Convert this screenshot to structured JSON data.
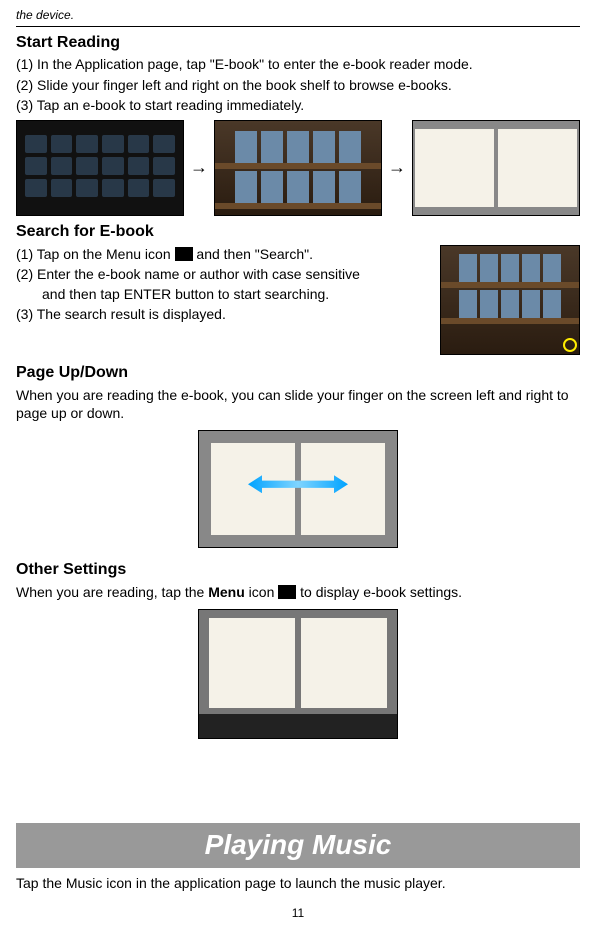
{
  "header_note": "the device.",
  "sections": {
    "start": {
      "title": "Start Reading",
      "line1": "(1) In the Application page, tap \"E-book\" to enter the e-book reader mode.",
      "line2": "(2) Slide your finger left and right on the book shelf to browse e-books.",
      "line3": "(3) Tap an e-book to start reading immediately."
    },
    "search": {
      "title": "Search for E-book",
      "line1_a": "(1) Tap on the Menu icon ",
      "line1_b": " and then \"Search\".",
      "line2": "(2) Enter the e-book name or author with case sensitive",
      "line2_cont": "and then tap ENTER button to start searching.",
      "line3": "(3) The search result is displayed."
    },
    "page": {
      "title": "Page Up/Down",
      "para": "When you are reading the e-book, you can slide your finger on the screen left and right to page up or down."
    },
    "other": {
      "title": "Other Settings",
      "para_a": "When you are reading, tap the ",
      "menu_word": "Menu",
      "para_b": " icon ",
      "para_c": " to display e-book settings."
    }
  },
  "banner": "Playing Music",
  "banner_sub": "Tap the Music icon in the application page to launch the music player.",
  "page_number": "11"
}
